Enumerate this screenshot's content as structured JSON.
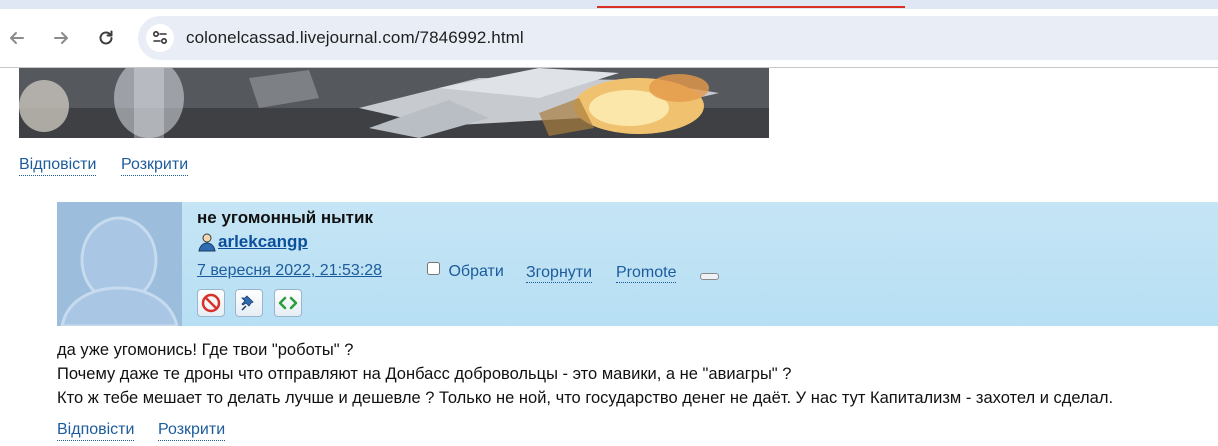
{
  "browser": {
    "url": "colonelcassad.livejournal.com/7846992.html",
    "back_icon": "back-arrow-icon",
    "forward_icon": "forward-arrow-icon",
    "reload_icon": "reload-icon",
    "site_info_icon": "site-info-icon"
  },
  "top_links": {
    "reply": "Відповісти",
    "expand": "Розкрити"
  },
  "comment": {
    "title": "не угомонный нытик",
    "username": "arlekcangp",
    "timestamp": "7 вересня 2022, 21:53:28",
    "select_label": "Обрати",
    "collapse_label": "Згорнути",
    "promote_label": "Promote",
    "body_lines": [
      "да уже угомонись! Где твои \"роботы\" ?",
      "Почему даже те дроны что отправляют на Донбасс добровольцы - это мавики, а не \"авиагры\" ?",
      "Кто ж тебе мешает то делать лучше и дешевле ? Только не ной, что государство денег не даёт. У нас тут Капитализм - захотел и сделал."
    ],
    "reply_label": "Відповісти",
    "expand_label": "Розкрити",
    "header_bg": "#bfe3f5",
    "link_color": "#1c5b9c"
  }
}
